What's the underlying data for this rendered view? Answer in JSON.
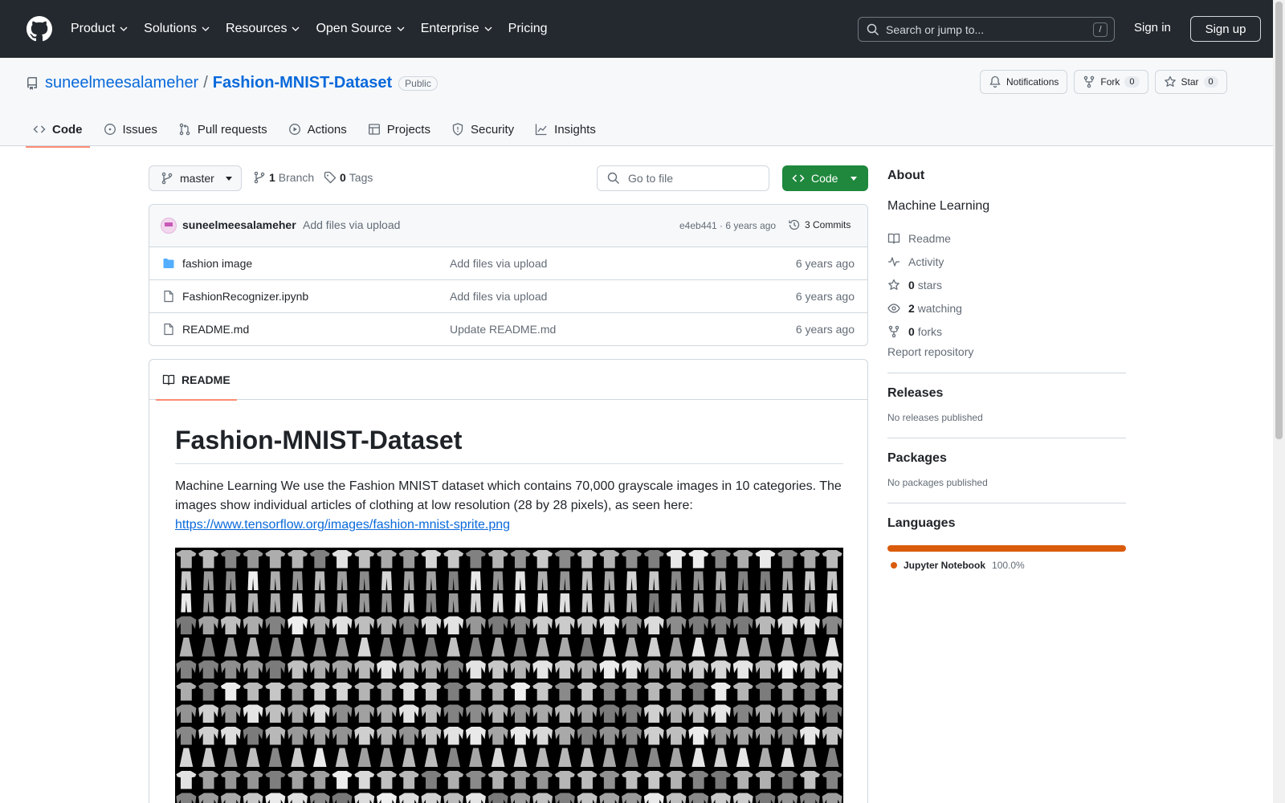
{
  "header": {
    "nav": [
      "Product",
      "Solutions",
      "Resources",
      "Open Source",
      "Enterprise",
      "Pricing"
    ],
    "search_placeholder": "Search or jump to...",
    "search_shortcut": "/",
    "sign_in": "Sign in",
    "sign_up": "Sign up"
  },
  "repo": {
    "owner": "suneelmeesalameher",
    "separator": "/",
    "name": "Fashion-MNIST-Dataset",
    "visibility": "Public",
    "notifications_label": "Notifications",
    "fork_label": "Fork",
    "fork_count": "0",
    "star_label": "Star",
    "star_count": "0",
    "tabs": [
      "Code",
      "Issues",
      "Pull requests",
      "Actions",
      "Projects",
      "Security",
      "Insights"
    ]
  },
  "browser": {
    "branch": "master",
    "branch_count": "1",
    "branch_label": "Branch",
    "tag_count": "0",
    "tag_label": "Tags",
    "goto_placeholder": "Go to file",
    "code_button": "Code",
    "commit": {
      "author": "suneelmeesalameher",
      "message": "Add files via upload",
      "meta": "e4eb441 · 6 years ago",
      "commits": "3 Commits"
    },
    "files": [
      {
        "name": "fashion image",
        "type": "folder",
        "message": "Add files via upload",
        "time": "6 years ago"
      },
      {
        "name": "FashionRecognizer.ipynb",
        "type": "file",
        "message": "Add files via upload",
        "time": "6 years ago"
      },
      {
        "name": "README.md",
        "type": "file",
        "message": "Update README.md",
        "time": "6 years ago"
      }
    ]
  },
  "readme": {
    "tab": "README",
    "title": "Fashion-MNIST-Dataset",
    "paragraph": "Machine Learning We use the Fashion MNIST dataset which contains 70,000 grayscale images in 10 categories. The images show individual articles of clothing at low resolution (28 by 28 pixels), as seen here:",
    "link": "https://www.tensorflow.org/images/fashion-mnist-sprite.png"
  },
  "about": {
    "heading": "About",
    "description": "Machine Learning",
    "readme": "Readme",
    "activity": "Activity",
    "stars_count": "0",
    "stars_label": "stars",
    "watching_count": "2",
    "watching_label": "watching",
    "forks_count": "0",
    "forks_label": "forks",
    "report": "Report repository"
  },
  "releases": {
    "heading": "Releases",
    "text": "No releases published"
  },
  "packages": {
    "heading": "Packages",
    "text": "No packages published"
  },
  "languages": {
    "heading": "Languages",
    "name": "Jupyter Notebook",
    "percent": "100.0%",
    "color": "#da5b0b",
    "fraction": 1.0
  },
  "colors": {
    "header_bg": "#24292f",
    "link": "#0969da",
    "code_button": "#1f883d",
    "tab_underline": "#fd8c73"
  }
}
